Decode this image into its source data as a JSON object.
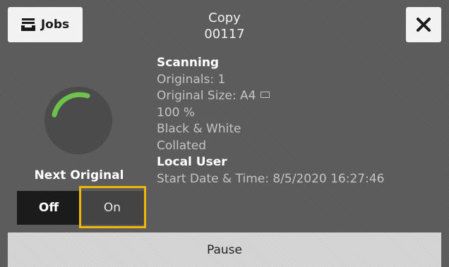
{
  "header": {
    "jobs_label": "Jobs",
    "title": "Copy",
    "job_number": "00117"
  },
  "status": {
    "scanning_title": "Scanning",
    "originals": "Originals: 1",
    "original_size": "Original Size: A4",
    "scale": "100 %",
    "color_mode": "Black & White",
    "collation": "Collated",
    "user": "Local User",
    "start_date_time": "Start Date & Time: 8/5/2020 16:27:46"
  },
  "next_original": {
    "label": "Next Original",
    "off_label": "Off",
    "on_label": "On",
    "selected": "On"
  },
  "footer": {
    "pause_label": "Pause"
  },
  "icons": {
    "jobs": "jobs-stack-icon",
    "close": "close-icon",
    "progress": "progress-spinner-icon",
    "paper_size": "paper-size-icon"
  },
  "colors": {
    "highlight": "#f2b705",
    "progress": "#6cc24a",
    "background": "#5a5a5a"
  }
}
